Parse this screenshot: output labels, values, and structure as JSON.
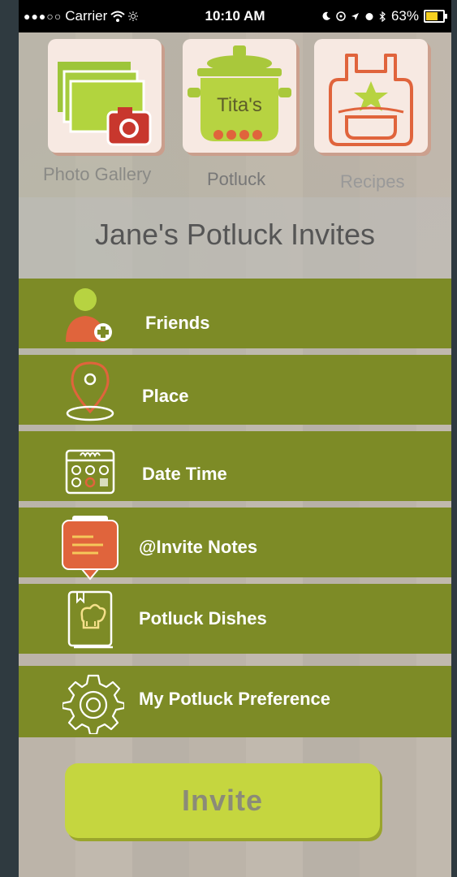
{
  "status_bar": {
    "signal": "●●●○○",
    "carrier": "Carrier",
    "time": "10:10 AM",
    "battery_percent": "63%",
    "battery_level": 0.63,
    "battery_color": "#f5d020"
  },
  "top_nav": {
    "photo_gallery_label": "Photo Gallery",
    "potluck_label": "Potluck",
    "potluck_pot_text": "Tita's",
    "recipes_label": "Recipes"
  },
  "page_title": "Jane's Potluck Invites",
  "menu": {
    "items": [
      {
        "label": "Friends",
        "icon": "add-friend-icon"
      },
      {
        "label": "Place",
        "icon": "location-pin-icon"
      },
      {
        "label": "Date Time",
        "icon": "calendar-icon"
      },
      {
        "label": "@Invite Notes",
        "icon": "notes-icon"
      },
      {
        "label": "Potluck Dishes",
        "icon": "recipe-book-icon"
      },
      {
        "label": "My Potluck Preference",
        "icon": "gear-icon"
      }
    ]
  },
  "invite_button_label": "Invite",
  "colors": {
    "menu_green": "#7d8b26",
    "accent_lime": "#c5d63f",
    "accent_orange": "#e0643c"
  }
}
